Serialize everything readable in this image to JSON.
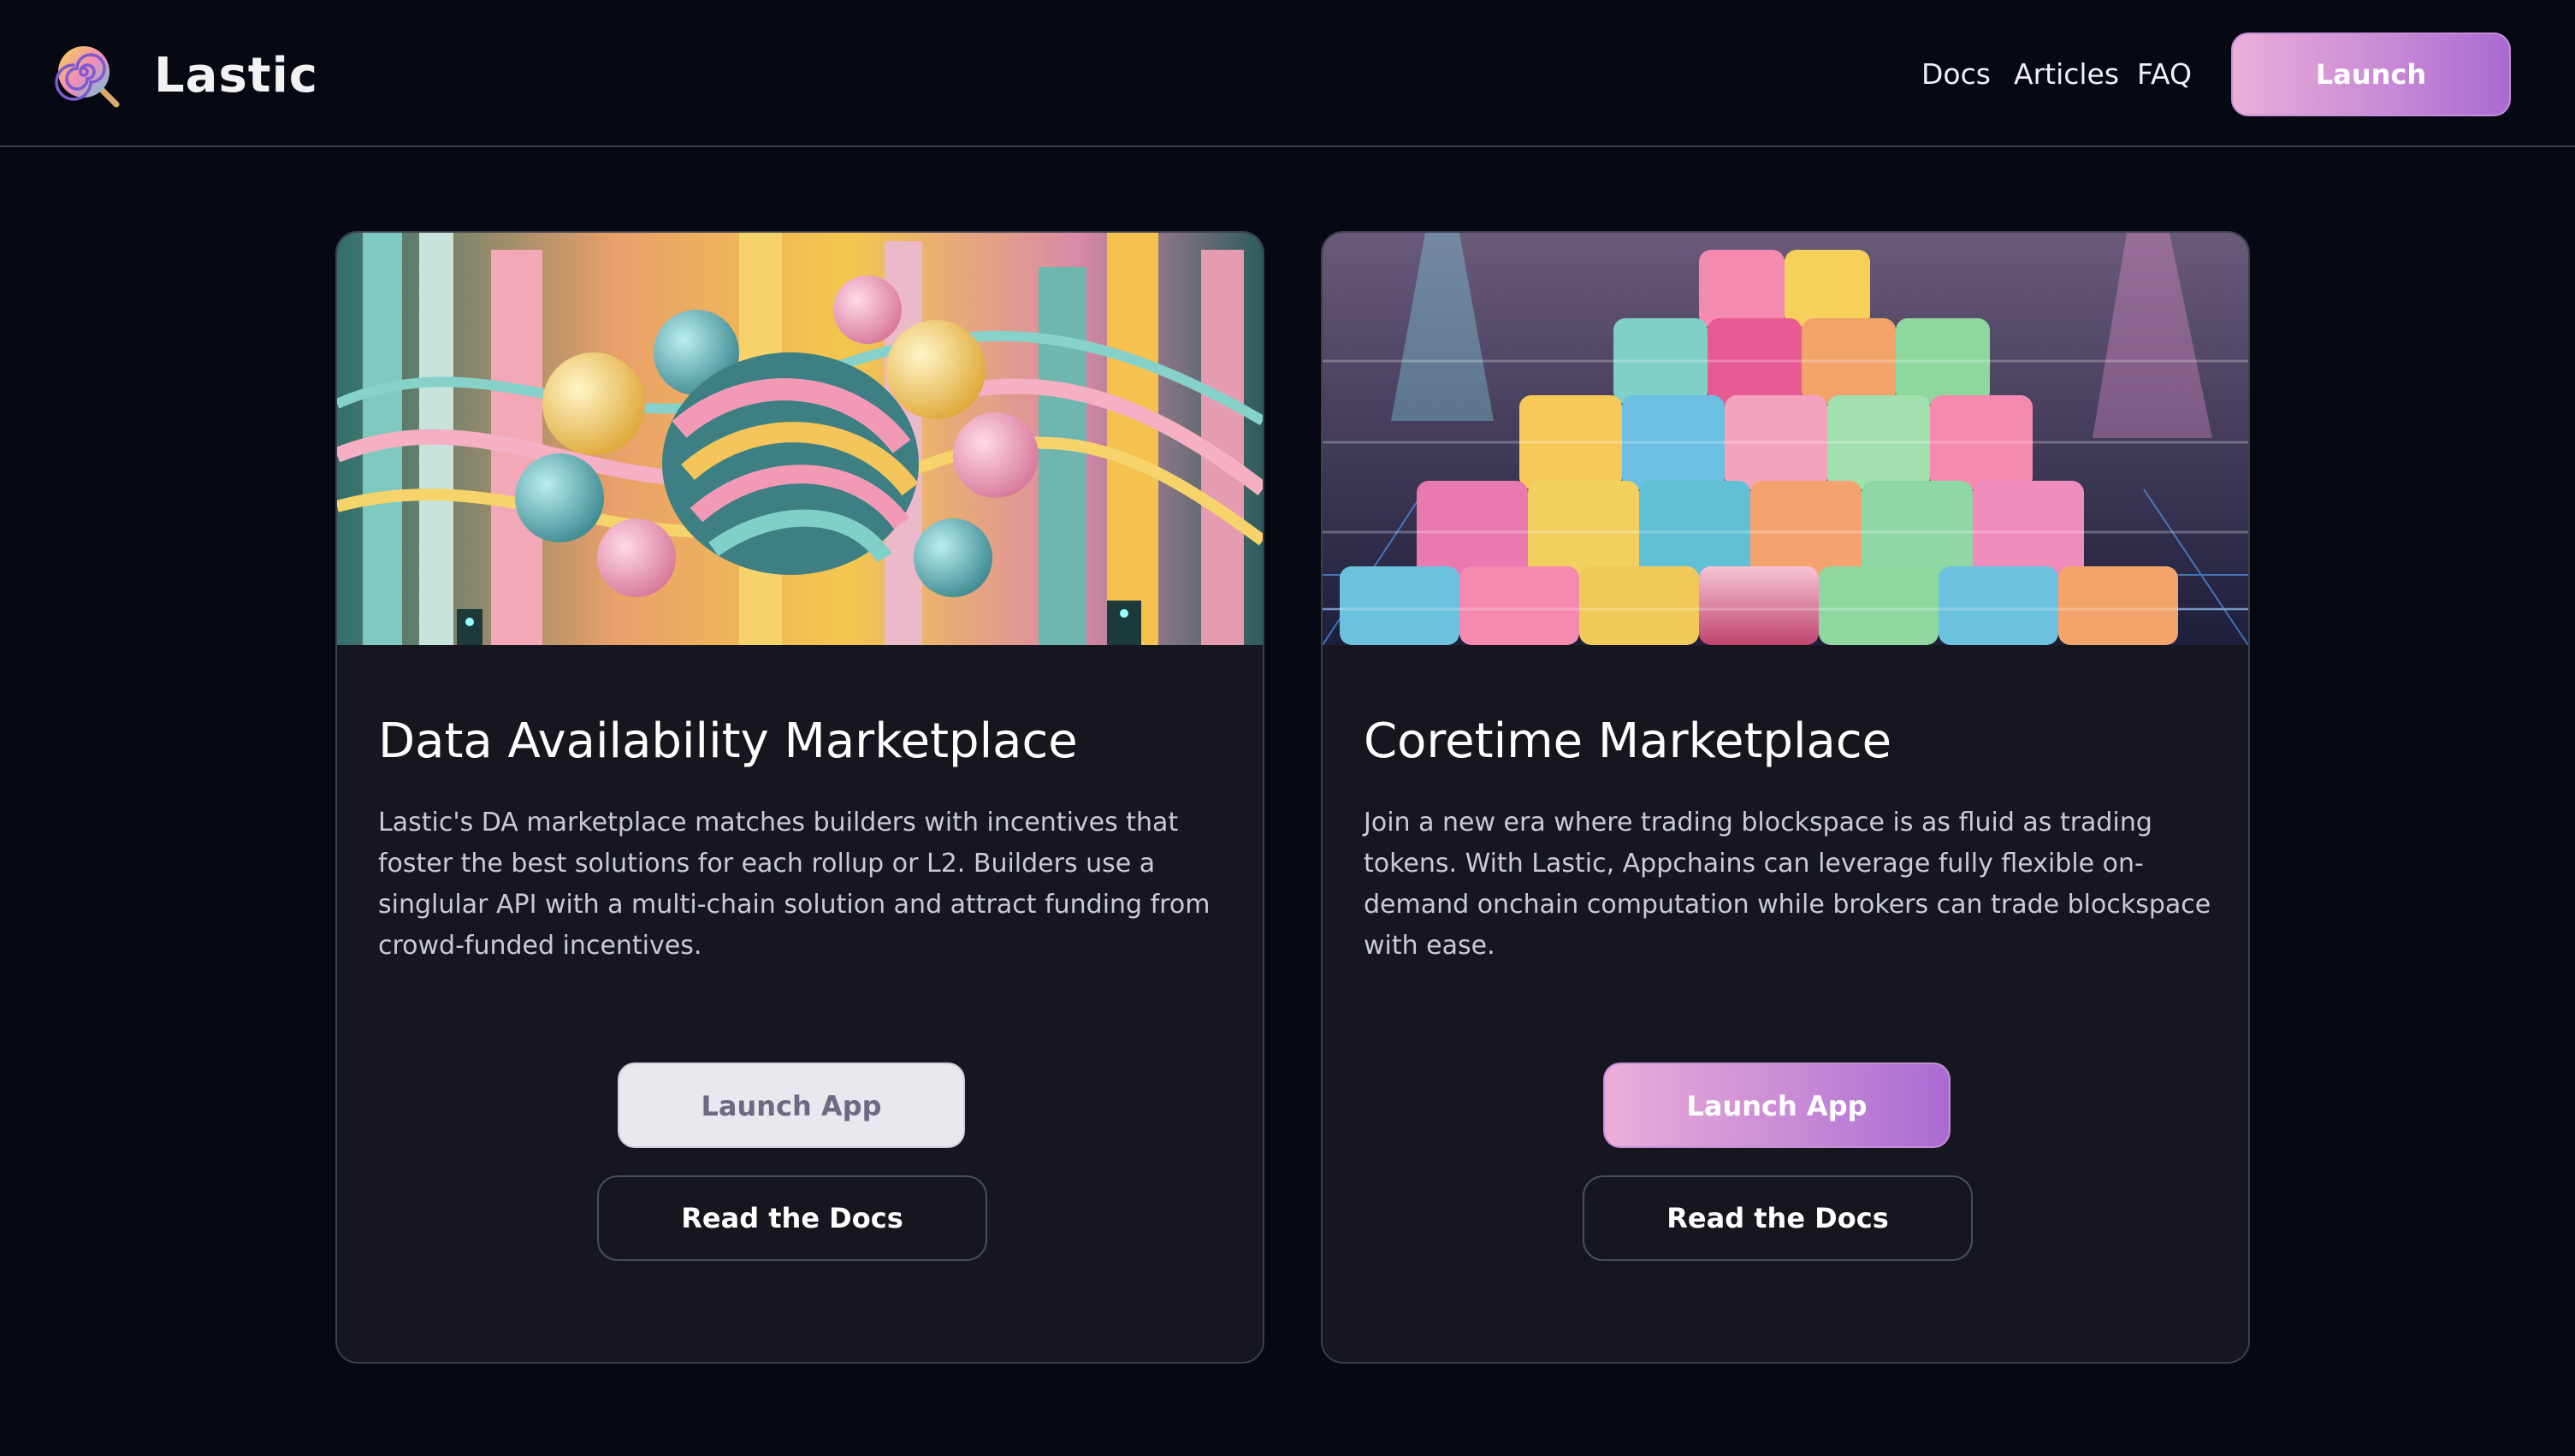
{
  "header": {
    "brand": "Lastic",
    "logo_icon": "lollipop-icon",
    "nav": [
      "Docs",
      "Articles",
      "FAQ"
    ],
    "launch_label": "Launch"
  },
  "cards": [
    {
      "image_icon": "abstract-candy-sculpture-image",
      "title": "Data Availability Marketplace",
      "description": "Lastic's DA marketplace matches builders with incentives that foster the best solutions for each rollup or L2. Builders use a singlular API with a multi-chain solution and attract funding from crowd-funded incentives.",
      "primary_label": "Launch App",
      "primary_state": "disabled",
      "secondary_label": "Read the Docs"
    },
    {
      "image_icon": "candy-cube-pyramid-image",
      "title": "Coretime Marketplace",
      "description": "Join a new era where trading blockspace is as fluid as trading tokens. With Lastic, Appchains can leverage fully flexible on-demand onchain computation while brokers can trade blockspace with ease.",
      "primary_label": "Launch App",
      "primary_state": "active",
      "secondary_label": "Read the Docs"
    }
  ],
  "colors": {
    "background": "#060812",
    "card": "#15161e",
    "accent_start": "#ecaed8",
    "accent_end": "#a96bd2"
  }
}
